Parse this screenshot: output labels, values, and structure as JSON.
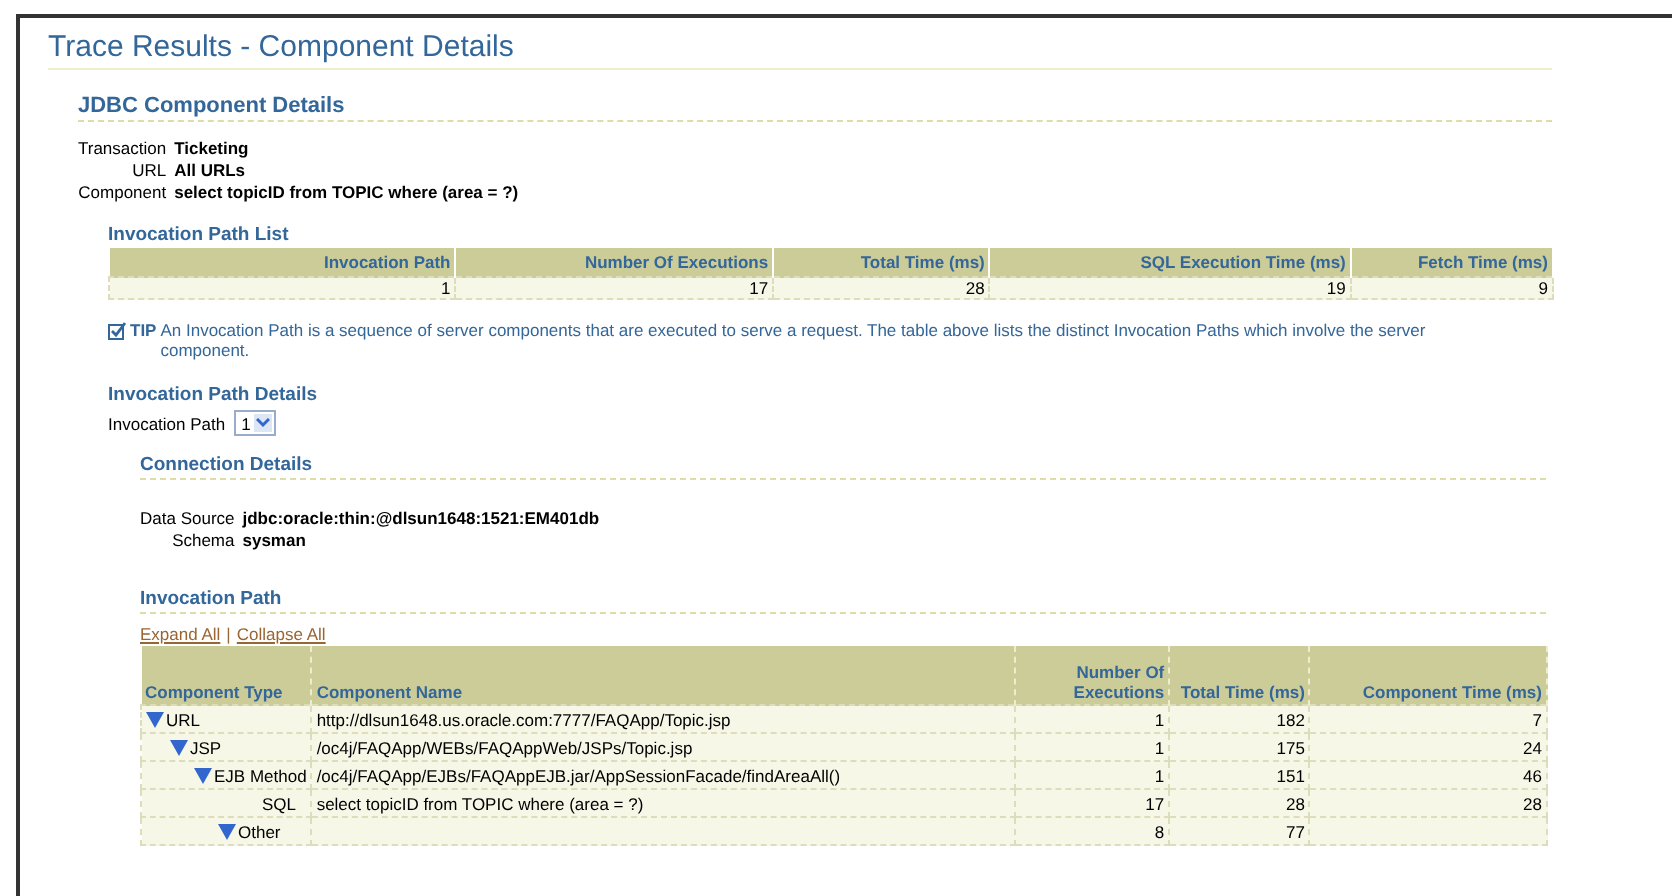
{
  "page_title": "Trace Results - Component Details",
  "jdbc": {
    "heading": "JDBC Component Details",
    "fields": [
      {
        "label": "Transaction",
        "value": "Ticketing"
      },
      {
        "label": "URL",
        "value": "All URLs"
      },
      {
        "label": "Component",
        "value": "select topicID from TOPIC where (area = ?)"
      }
    ]
  },
  "invocation_path_list": {
    "heading": "Invocation Path List",
    "columns": [
      "Invocation Path",
      "Number Of Executions",
      "Total Time (ms)",
      "SQL Execution Time (ms)",
      "Fetch Time (ms)"
    ],
    "rows": [
      [
        "1",
        "17",
        "28",
        "19",
        "9"
      ]
    ]
  },
  "tip": {
    "label": "TIP",
    "text": "An Invocation Path is a sequence of server components that are executed to serve a request. The table above lists the distinct Invocation Paths which involve the server component."
  },
  "invocation_path_details": {
    "heading": "Invocation Path Details",
    "selector_label": "Invocation Path",
    "selector_value": "1"
  },
  "connection_details": {
    "heading": "Connection Details",
    "fields": [
      {
        "label": "Data Source",
        "value": "jdbc:oracle:thin:@dlsun1648:1521:EM401db"
      },
      {
        "label": "Schema",
        "value": "sysman"
      }
    ]
  },
  "invocation_path": {
    "heading": "Invocation Path",
    "expand_all": "Expand All",
    "separator": "|",
    "collapse_all": "Collapse All",
    "columns": [
      "Component Type",
      "Component Name",
      "Number Of Executions",
      "Total Time (ms)",
      "Component Time (ms)"
    ],
    "tree": [
      {
        "type": "URL",
        "name": "http://dlsun1648.us.oracle.com:7777/FAQApp/Topic.jsp",
        "executions": "1",
        "total": "182",
        "component": "7",
        "expanded": true,
        "children": [
          {
            "type": "JSP",
            "name": "/oc4j/FAQApp/WEBs/FAQAppWeb/JSPs/Topic.jsp",
            "executions": "1",
            "total": "175",
            "component": "24",
            "expanded": true,
            "children": [
              {
                "type": "EJB Method",
                "name": "/oc4j/FAQApp/EJBs/FAQAppEJB.jar/AppSessionFacade/findAreaAll()",
                "executions": "1",
                "total": "151",
                "component": "46",
                "expanded": true,
                "children": [
                  {
                    "type": "SQL",
                    "name": "select topicID from TOPIC where (area = ?)",
                    "executions": "17",
                    "total": "28",
                    "component": "28"
                  },
                  {
                    "type": "Other",
                    "executions": "8",
                    "total": "77",
                    "expanded": true
                  }
                ]
              }
            ]
          }
        ]
      }
    ]
  }
}
